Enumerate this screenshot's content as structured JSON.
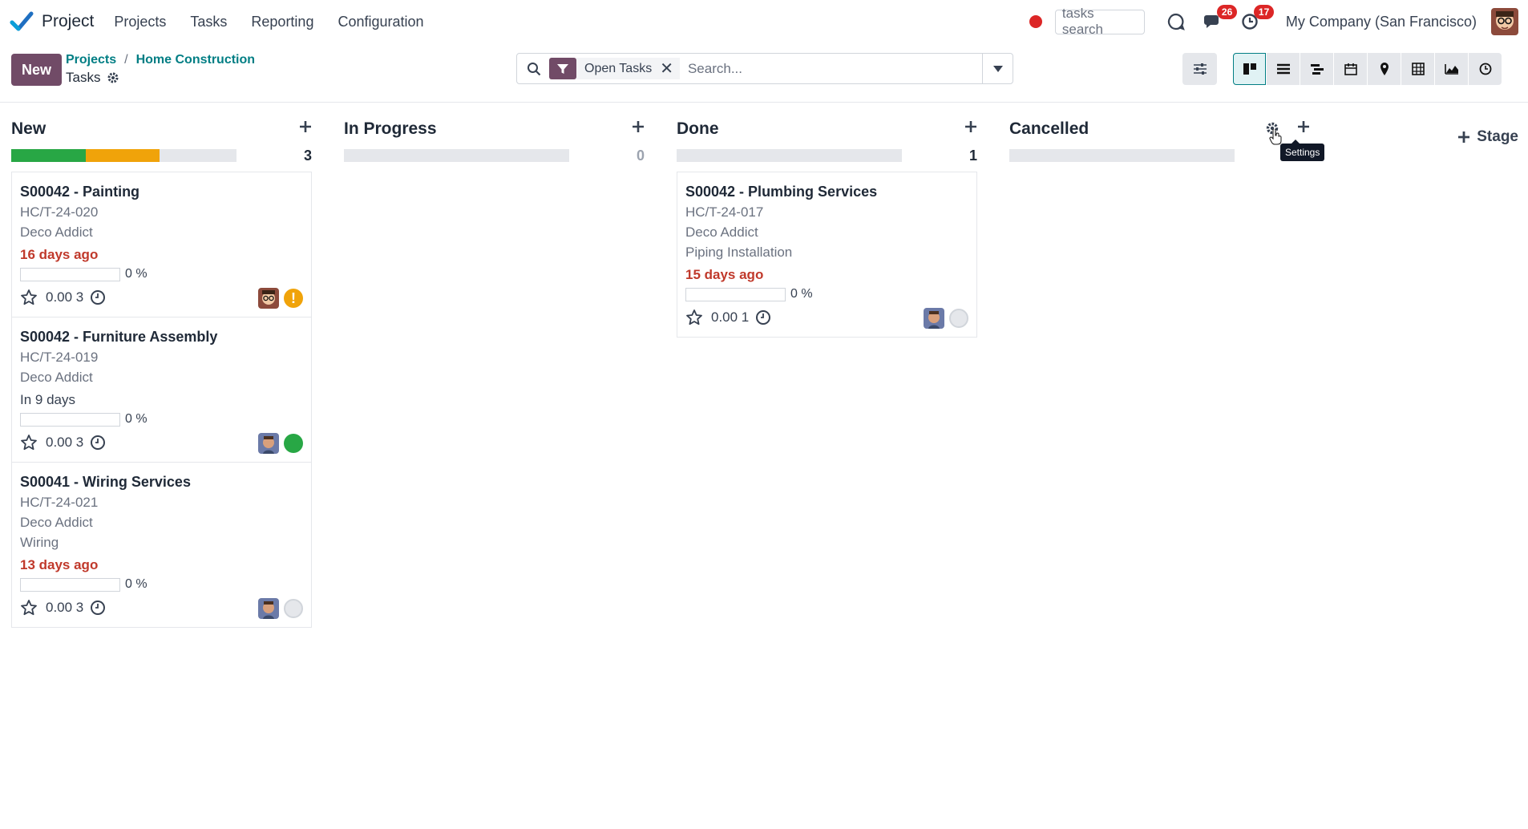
{
  "navbar": {
    "app_name": "Project",
    "menu": [
      "Projects",
      "Tasks",
      "Reporting",
      "Configuration"
    ],
    "quick_search": "tasks search",
    "discuss_badge": "26",
    "activity_badge": "17",
    "company": "My Company (San Francisco)"
  },
  "control": {
    "new_label": "New",
    "breadcrumb": [
      "Projects",
      "Home Construction"
    ],
    "title": "Tasks",
    "facet_label": "Open Tasks",
    "facet_remove": "✕",
    "search_placeholder": "Search..."
  },
  "columns": [
    {
      "title": "New",
      "count": "3",
      "progress": {
        "green": 0.33,
        "orange": 0.33
      },
      "cards": [
        {
          "title": "S00042 - Painting",
          "ref": "HC/T-24-020",
          "customer": "Deco Addict",
          "tag": "",
          "date": "16 days ago",
          "date_state": "overdue",
          "progress": "0 %",
          "hours": "0.00 3",
          "state": "orange"
        },
        {
          "title": "S00042 - Furniture Assembly",
          "ref": "HC/T-24-019",
          "customer": "Deco Addict",
          "tag": "",
          "date": "In 9 days",
          "date_state": "normal",
          "progress": "0 %",
          "hours": "0.00 3",
          "state": "green"
        },
        {
          "title": "S00041 - Wiring Services",
          "ref": "HC/T-24-021",
          "customer": "Deco Addict",
          "tag": "Wiring",
          "date": "13 days ago",
          "date_state": "overdue",
          "progress": "0 %",
          "hours": "0.00 3",
          "state": "grey"
        }
      ]
    },
    {
      "title": "In Progress",
      "count": "0",
      "cards": []
    },
    {
      "title": "Done",
      "count": "1",
      "cards": [
        {
          "title": "S00042 - Plumbing Services",
          "ref": "HC/T-24-017",
          "customer": "Deco Addict",
          "tag": "Piping Installation",
          "date": "15 days ago",
          "date_state": "overdue",
          "progress": "0 %",
          "hours": "0.00 1",
          "state": "grey"
        }
      ]
    },
    {
      "title": "Cancelled",
      "count": "",
      "cards": []
    }
  ],
  "tooltip": "Settings",
  "add_stage": "Stage",
  "colors": {
    "brand": "#714b67",
    "link": "#017e84",
    "overdue": "#c0392b",
    "green": "#28a745",
    "orange": "#f0a30a"
  }
}
